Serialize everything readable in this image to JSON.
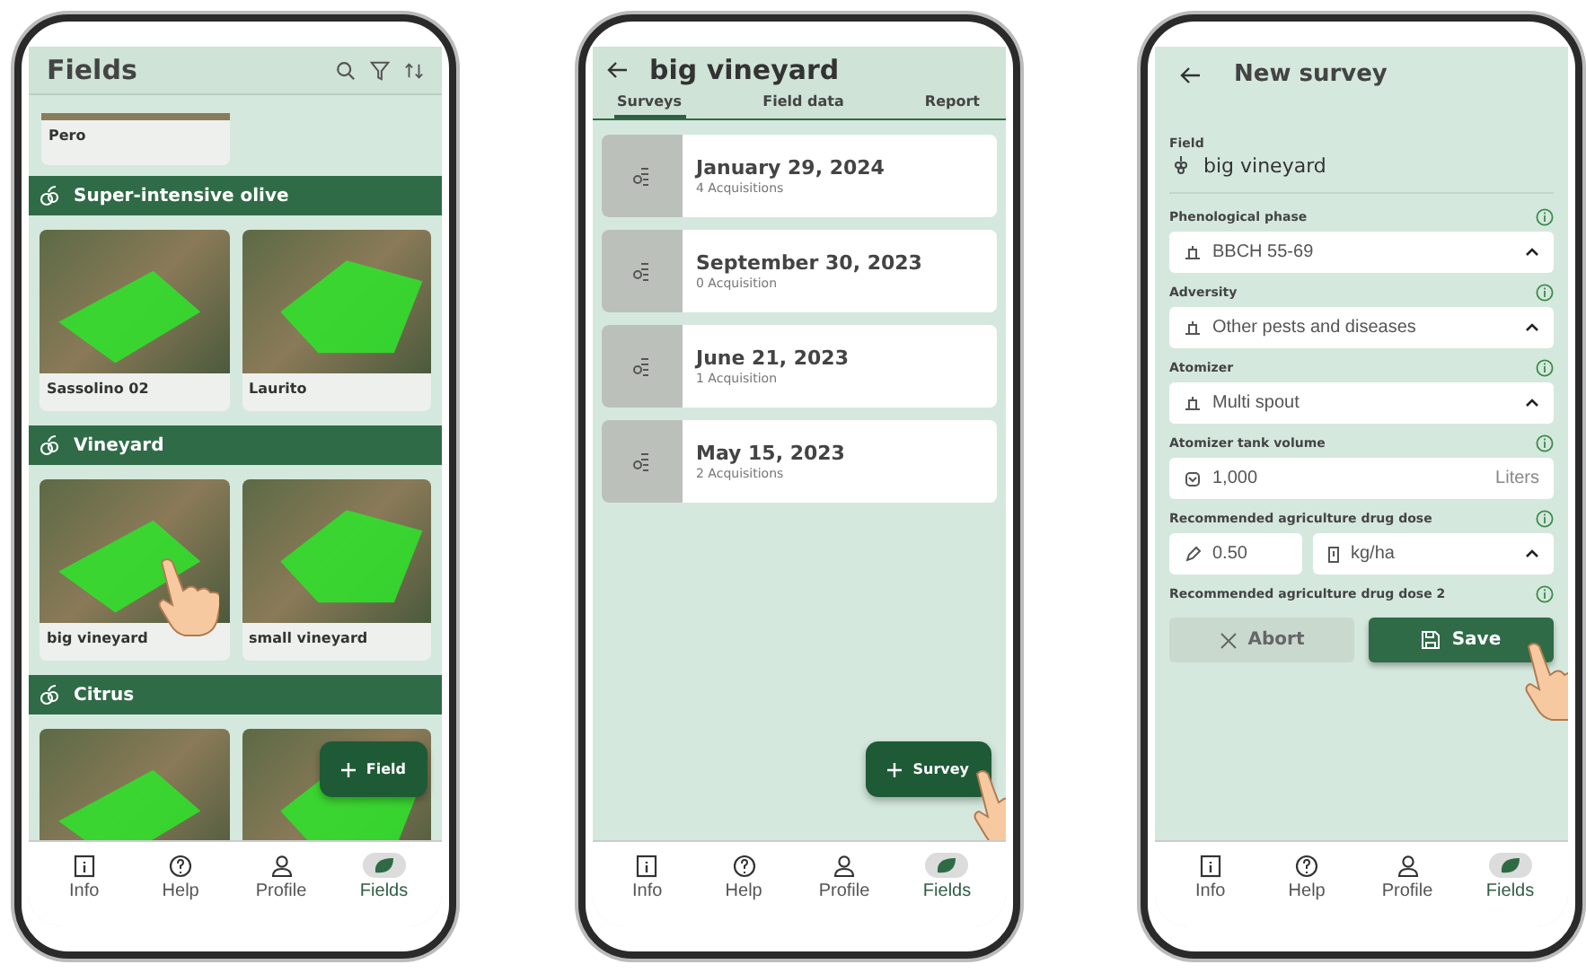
{
  "fields_screen": {
    "title": "Fields",
    "partial_card": {
      "name": "Pero"
    },
    "groups": [
      {
        "name": "Super-intensive olive",
        "fields": [
          {
            "kind": "named",
            "name": "Sassolino 02",
            "touched": false
          },
          {
            "kind": "named",
            "name": "Laurito",
            "touched": false
          }
        ]
      },
      {
        "name": "Vineyard",
        "fields": [
          {
            "kind": "named",
            "name": "big vineyard",
            "touched": true
          },
          {
            "kind": "named",
            "name": "small vineyard",
            "touched": false
          }
        ]
      },
      {
        "name": "Citrus",
        "fields": [
          {
            "kind": "photo",
            "touched": false
          },
          {
            "kind": "photo",
            "touched": false
          }
        ]
      }
    ],
    "fab": {
      "label": "Field",
      "touched": false
    },
    "nav": [
      {
        "label": "Info",
        "selected": false
      },
      {
        "label": "Help",
        "selected": false
      },
      {
        "label": "Profile",
        "selected": false
      },
      {
        "label": "Fields",
        "selected": true
      }
    ]
  },
  "survey_list_screen": {
    "title": "big vineyard",
    "tabs": [
      {
        "label": "Surveys",
        "selected": true
      },
      {
        "label": "Field data",
        "selected": false
      },
      {
        "label": "Report",
        "selected": false
      }
    ],
    "surveys": [
      {
        "date": "January 29, 2024",
        "count": "4 Acquisitions"
      },
      {
        "date": "September 30, 2023",
        "count": "0 Acquisition"
      },
      {
        "date": "June 21, 2023",
        "count": "1 Acquisition"
      },
      {
        "date": "May 15, 2023",
        "count": "2 Acquisitions"
      }
    ],
    "fab": {
      "label": "Survey",
      "touched": true
    },
    "nav": [
      {
        "label": "Info",
        "selected": false
      },
      {
        "label": "Help",
        "selected": false
      },
      {
        "label": "Profile",
        "selected": false
      },
      {
        "label": "Fields",
        "selected": true
      }
    ]
  },
  "new_survey_screen": {
    "title": "New survey",
    "field_label": "Field",
    "field_value": "big vineyard",
    "form": [
      {
        "kind": "select",
        "label": "Phenological phase",
        "value": "BBCH 55-69"
      },
      {
        "kind": "select",
        "label": "Adversity",
        "value": "Other pests and diseases"
      },
      {
        "kind": "select",
        "label": "Atomizer",
        "value": "Multi spout"
      },
      {
        "kind": "input",
        "label": "Atomizer tank volume",
        "value": "1,000",
        "unit": "Liters"
      },
      {
        "kind": "dose",
        "label": "Recommended agriculture drug dose",
        "value": "0.50",
        "unit": "kg/ha"
      },
      {
        "kind": "label",
        "label": "Recommended agriculture drug dose 2"
      }
    ],
    "buttons": [
      {
        "kind": "abort",
        "label": "Abort",
        "touched": false
      },
      {
        "kind": "save",
        "label": "Save",
        "touched": true
      }
    ],
    "nav": [
      {
        "label": "Info",
        "selected": false
      },
      {
        "label": "Help",
        "selected": false
      },
      {
        "label": "Profile",
        "selected": false
      },
      {
        "label": "Fields",
        "selected": true
      }
    ]
  }
}
